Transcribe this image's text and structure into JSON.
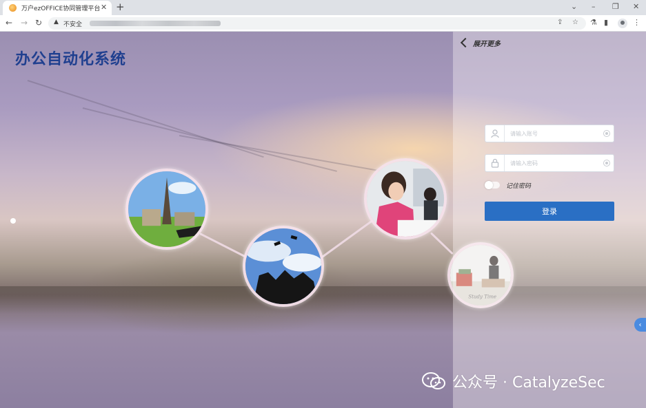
{
  "browser": {
    "tab": {
      "title": "万户ezOFFICE协同管理平台",
      "close_glyph": "✕"
    },
    "new_tab_glyph": "+",
    "window_controls": {
      "dropdown": "⌄",
      "minimize": "–",
      "restore": "❐",
      "close": "✕"
    },
    "nav": {
      "back": "←",
      "forward": "→",
      "reload": "↻"
    },
    "address": {
      "warning_glyph": "▲",
      "insecure_label": "不安全",
      "url": ""
    },
    "toolbar_icons": [
      "share-icon",
      "star-icon",
      "lab-icon",
      "sidepanel-icon",
      "profile-icon",
      "menu-icon"
    ]
  },
  "page": {
    "system_title": "办公自动化系统",
    "login": {
      "expand_label": "展开更多",
      "username_placeholder": "请输入账号",
      "password_placeholder": "请输入密码",
      "remember_label": "记住密码",
      "login_button": "登录"
    },
    "side_tab_glyph": "‹",
    "watermark": "公众号 · CatalyzeSec"
  },
  "colors": {
    "title": "#1f3f8f",
    "login_button": "#2a6fc4",
    "side_tab": "#4a8be0"
  }
}
